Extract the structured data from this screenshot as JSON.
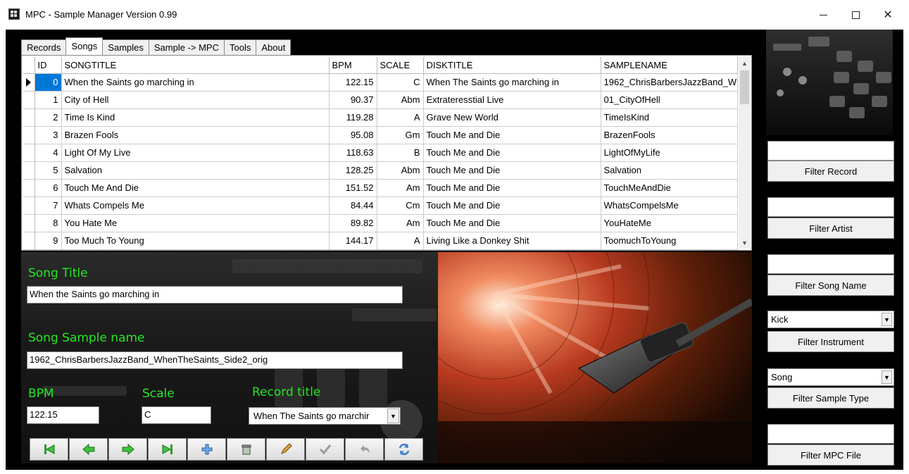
{
  "window": {
    "title": "MPC - Sample Manager Version 0.99",
    "min_glyph": "—",
    "max_glyph": "☐",
    "close_glyph": "✕"
  },
  "tabs": [
    {
      "label": "Records"
    },
    {
      "label": "Songs"
    },
    {
      "label": "Samples"
    },
    {
      "label": "Sample -> MPC"
    },
    {
      "label": "Tools"
    },
    {
      "label": "About"
    }
  ],
  "grid": {
    "headers": [
      "ID",
      "SONGTITLE",
      "BPM",
      "SCALE",
      "DISKTITLE",
      "SAMPLENAME"
    ],
    "rows": [
      {
        "id": "0",
        "title": "When the Saints go marching in",
        "bpm": "122.15",
        "scale": "C",
        "disk": "When The Saints go marching in",
        "sample": "1962_ChrisBarbersJazzBand_W"
      },
      {
        "id": "1",
        "title": "City of Hell",
        "bpm": "90.37",
        "scale": "Abm",
        "disk": "Extrateresstial Live",
        "sample": "01_CityOfHell"
      },
      {
        "id": "2",
        "title": "Time Is Kind",
        "bpm": "119.28",
        "scale": "A",
        "disk": "Grave New World",
        "sample": "TimeIsKind"
      },
      {
        "id": "3",
        "title": "Brazen Fools",
        "bpm": "95.08",
        "scale": "Gm",
        "disk": "Touch Me and Die",
        "sample": "BrazenFools"
      },
      {
        "id": "4",
        "title": "Light Of My Live",
        "bpm": "118.63",
        "scale": "B",
        "disk": "Touch Me and Die",
        "sample": "LightOfMyLife"
      },
      {
        "id": "5",
        "title": "Salvation",
        "bpm": "128.25",
        "scale": "Abm",
        "disk": "Touch Me and Die",
        "sample": "Salvation"
      },
      {
        "id": "6",
        "title": "Touch Me And Die",
        "bpm": "151.52",
        "scale": "Am",
        "disk": "Touch Me and Die",
        "sample": "TouchMeAndDie"
      },
      {
        "id": "7",
        "title": "Whats Compels Me",
        "bpm": "84.44",
        "scale": "Cm",
        "disk": "Touch Me and Die",
        "sample": "WhatsCompelsMe"
      },
      {
        "id": "8",
        "title": "You Hate Me",
        "bpm": "89.82",
        "scale": "Am",
        "disk": "Touch Me and Die",
        "sample": "YouHateMe"
      },
      {
        "id": "9",
        "title": "Too Much To Young",
        "bpm": "144.17",
        "scale": "A",
        "disk": "Living Like a Donkey Shit",
        "sample": "ToomuchToYoung"
      }
    ]
  },
  "detail": {
    "song_title_label": "Song Title",
    "song_title_value": "When the Saints go marching in",
    "sample_name_label": "Song Sample name",
    "sample_name_value": "1962_ChrisBarbersJazzBand_WhenTheSaints_Side2_orig",
    "bpm_label": "BPM",
    "bpm_value": "122.15",
    "scale_label": "Scale",
    "scale_value": "C",
    "record_title_label": "Record title",
    "record_title_value": "When The Saints go marchir"
  },
  "nav_icons": [
    "first-icon",
    "prior-icon",
    "next-icon",
    "last-icon",
    "insert-icon",
    "delete-icon",
    "edit-icon",
    "post-icon",
    "cancel-icon",
    "refresh-icon"
  ],
  "filters": {
    "record_button": "Filter Record",
    "artist_button": "Filter Artist",
    "song_button": "Filter Song Name",
    "instrument_value": "Kick",
    "instrument_button": "Filter Instrument",
    "sample_type_value": "Song",
    "sample_type_button": "Filter Sample Type",
    "mpc_button": "Filter MPC File"
  },
  "colors": {
    "label_green": "#22e822",
    "selection_blue": "#0078d7",
    "background": "#000000"
  }
}
